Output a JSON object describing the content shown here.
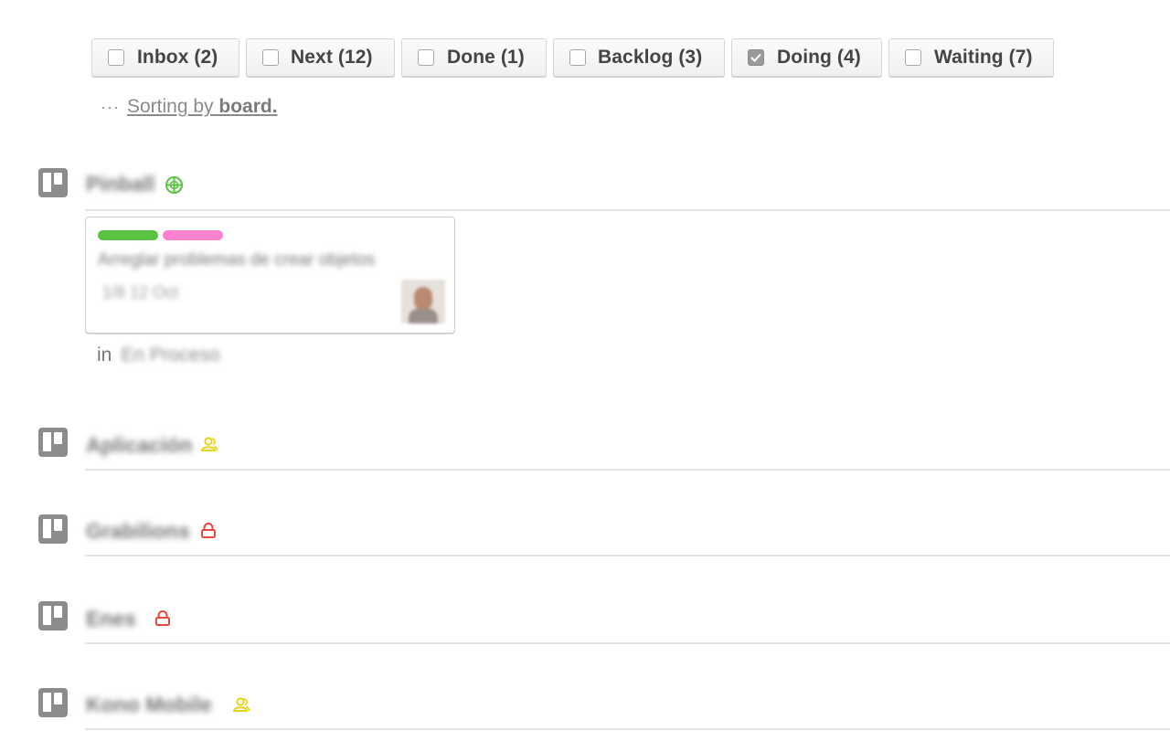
{
  "filters": [
    {
      "label": "Inbox (2)",
      "checked": false
    },
    {
      "label": "Next (12)",
      "checked": false
    },
    {
      "label": "Done (1)",
      "checked": false
    },
    {
      "label": "Backlog (3)",
      "checked": false
    },
    {
      "label": "Doing (4)",
      "checked": true
    },
    {
      "label": "Waiting (7)",
      "checked": false
    }
  ],
  "sorting": {
    "dots": "···",
    "prefix": "Sorting by ",
    "value": "board."
  },
  "boards": [
    {
      "name": "Pinball",
      "visibility_icon": "globe-icon",
      "visibility_color": "#5ac241"
    },
    {
      "name": "Aplicación",
      "visibility_icon": "team-icon",
      "visibility_color": "#e8d41a"
    },
    {
      "name": "Grabilions",
      "visibility_icon": "lock-icon",
      "visibility_color": "#e8493a"
    },
    {
      "name": "Enes",
      "visibility_icon": "lock-icon",
      "visibility_color": "#e8493a"
    },
    {
      "name": "Kono Mobile",
      "visibility_icon": "team-icon",
      "visibility_color": "#e8d41a"
    }
  ],
  "card": {
    "labels": [
      "#5ac241",
      "#ff80ce"
    ],
    "title": "Arreglar problemas de crear objetos",
    "meta": "1/8  12 Oct",
    "list_prefix": "in",
    "list_name": "En Proceso"
  }
}
